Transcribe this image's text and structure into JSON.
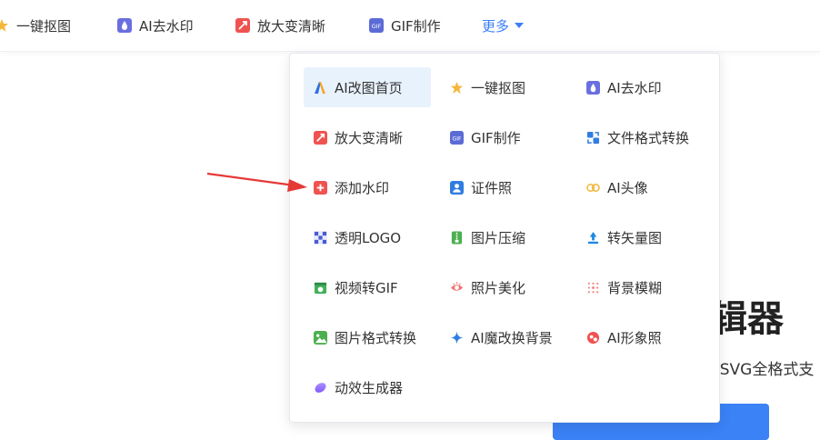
{
  "nav": {
    "items": [
      {
        "label": "一键抠图",
        "icon": "star-cutout-icon"
      },
      {
        "label": "AI去水印",
        "icon": "ai-watermark-icon"
      },
      {
        "label": "放大变清晰",
        "icon": "enlarge-icon"
      },
      {
        "label": "GIF制作",
        "icon": "gif-icon"
      }
    ],
    "more_label": "更多"
  },
  "dropdown": {
    "rows": [
      [
        {
          "label": "AI改图首页",
          "icon": "ai-logo-icon"
        },
        {
          "label": "一键抠图",
          "icon": "star-cutout-icon"
        },
        {
          "label": "AI去水印",
          "icon": "ai-watermark-icon"
        }
      ],
      [
        {
          "label": "放大变清晰",
          "icon": "enlarge-icon"
        },
        {
          "label": "GIF制作",
          "icon": "gif-icon"
        },
        {
          "label": "文件格式转换",
          "icon": "format-convert-icon"
        }
      ],
      [
        {
          "label": "添加水印",
          "icon": "add-watermark-icon"
        },
        {
          "label": "证件照",
          "icon": "id-photo-icon"
        },
        {
          "label": "AI头像",
          "icon": "ai-avatar-icon"
        }
      ],
      [
        {
          "label": "透明LOGO",
          "icon": "transparent-logo-icon"
        },
        {
          "label": "图片压缩",
          "icon": "compress-icon"
        },
        {
          "label": "转矢量图",
          "icon": "vector-icon"
        }
      ],
      [
        {
          "label": "视频转GIF",
          "icon": "video-gif-icon"
        },
        {
          "label": "照片美化",
          "icon": "beautify-icon"
        },
        {
          "label": "背景模糊",
          "icon": "blur-icon"
        }
      ],
      [
        {
          "label": "图片格式转换",
          "icon": "image-format-icon"
        },
        {
          "label": "AI魔改换背景",
          "icon": "ai-background-icon"
        },
        {
          "label": "AI形象照",
          "icon": "ai-portrait-icon"
        }
      ],
      [
        {
          "label": "动效生成器",
          "icon": "motion-icon"
        }
      ]
    ]
  },
  "background": {
    "title_fragment": "辑器",
    "subtitle_fragment": "/SVG全格式支"
  },
  "colors": {
    "accent": "#3b7ff5",
    "active_bg": "#e8f2fd",
    "arrow": "#e53935"
  }
}
